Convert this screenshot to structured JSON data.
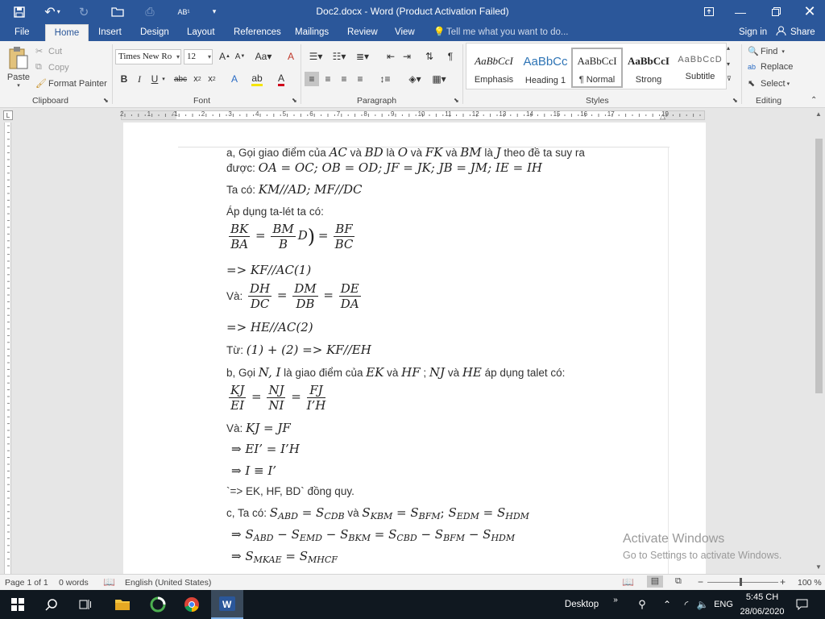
{
  "app": {
    "title": "Doc2.docx - Word (Product Activation Failed)"
  },
  "tabs": [
    "File",
    "Home",
    "Insert",
    "Design",
    "Layout",
    "References",
    "Mailings",
    "Review",
    "View"
  ],
  "tell_me": "Tell me what you want to do...",
  "account": {
    "sign_in": "Sign in",
    "share": "Share"
  },
  "clipboard": {
    "paste": "Paste",
    "cut": "Cut",
    "copy": "Copy",
    "format_painter": "Format Painter",
    "group": "Clipboard"
  },
  "font": {
    "name": "Times New Ro",
    "size": "12",
    "group": "Font"
  },
  "paragraph": {
    "group": "Paragraph"
  },
  "styles": {
    "group": "Styles",
    "items": [
      {
        "preview": "AaBbCcI",
        "name": "Emphasis"
      },
      {
        "preview": "AaBbCc",
        "name": "Heading 1"
      },
      {
        "preview": "AaBbCcI",
        "name": "¶ Normal"
      },
      {
        "preview": "AaBbCcI",
        "name": "Strong"
      },
      {
        "preview": "AaBbCcD",
        "name": "Subtitle"
      }
    ]
  },
  "editing": {
    "find": "Find",
    "replace": "Replace",
    "select": "Select",
    "group": "Editing"
  },
  "ruler_numbers": [
    "2",
    "1",
    "1",
    "2",
    "3",
    "4",
    "5",
    "6",
    "7",
    "8",
    "9",
    "10",
    "11",
    "12",
    "13",
    "14",
    "15",
    "16",
    "17",
    "19"
  ],
  "doc": {
    "l1": {
      "a": "a, Gọi giao điểm của ",
      "ac": "AC",
      "b": " và ",
      "bd": "BD",
      "c": " là ",
      "o": "O",
      "d": " và ",
      "fk": "FK",
      "e": " và ",
      "bm": "BM",
      "f": " là ",
      "j": "J",
      "g": " theo đề ta suy ra"
    },
    "l2": {
      "a": "được: ",
      "eq": "OA = OC; OB = OD; JF = JK; JB = JM; IE = IH"
    },
    "l3": {
      "a": "Ta có: ",
      "eq": "KM//AD; MF//DC"
    },
    "l4": "Áp dụng ta-lét ta có:",
    "l5": {
      "n1": "BK",
      "d1": "BA",
      "eq1": "=",
      "n2": "BM",
      "d2": "B",
      "tail": "D",
      "paren": ")",
      "eq2": "=",
      "n3": "BF",
      "d3": "BC"
    },
    "l6": "=> KF//AC(1)",
    "l7": {
      "a": "Và: ",
      "n1": "DH",
      "d1": "DC",
      "eq1": "=",
      "n2": "DM",
      "d2": "DB",
      "eq2": "=",
      "n3": "DE",
      "d3": "DA"
    },
    "l8": "=> HE//AC(2)",
    "l9": {
      "a": "Từ: ",
      "eq": "(1) + (2) => KF//EH"
    },
    "l10": {
      "a": "b, Gọi ",
      "ni": "N, I",
      "b": " là giao điểm của ",
      "ek": "EK",
      "c": " và ",
      "hf": "HF",
      "d": " ; ",
      "nj": "NJ",
      "e": " và ",
      "he": "HE",
      "f": " áp dụng talet có:"
    },
    "l11": {
      "n1": "KJ",
      "d1": "EI",
      "eq1": "=",
      "n2": "NJ",
      "d2": "NI",
      "eq2": "=",
      "n3": "FJ",
      "d3": "I’H"
    },
    "l12": {
      "a": "Và: ",
      "eq": "KJ = JF"
    },
    "l13": "⇒ EI’ = I’H",
    "l14": "⇒ I ≡ I’",
    "l15": "`=> EK, HF, BD` đồng quy.",
    "l16": {
      "a": "c, Ta có: ",
      "s1": "S",
      "s1s": "ABD",
      "eq1": " = ",
      "s2": "S",
      "s2s": "CDB",
      "b": " và ",
      "s3": "S",
      "s3s": "KBM",
      "eq2": " = ",
      "s4": "S",
      "s4s": "BFM",
      "c": "; ",
      "s5": "S",
      "s5s": "EDM",
      "eq3": " = ",
      "s6": "S",
      "s6s": "HDM"
    },
    "l17": {
      "pre": "⇒ ",
      "s1": "S",
      "s1s": "ABD",
      "m1": " − ",
      "s2": "S",
      "s2s": "EMD",
      "m2": " − ",
      "s3": "S",
      "s3s": "BKM",
      "eq": " = ",
      "s4": "S",
      "s4s": "CBD",
      "m3": " − ",
      "s5": "S",
      "s5s": "BFM",
      "m4": " − ",
      "s6": "S",
      "s6s": "HDM"
    },
    "l18": {
      "pre": "⇒ ",
      "s1": "S",
      "s1s": "MKAE",
      "eq": " = ",
      "s2": "S",
      "s2s": "MHCF"
    }
  },
  "watermark": {
    "title": "Activate Windows",
    "sub": "Go to Settings to activate Windows."
  },
  "status": {
    "page": "Page 1 of 1",
    "words": "0 words",
    "language": "English (United States)",
    "zoom": "100 %"
  },
  "taskbar": {
    "desktop": "Desktop",
    "lang": "ENG",
    "time": "5:45 CH",
    "date": "28/06/2020"
  }
}
